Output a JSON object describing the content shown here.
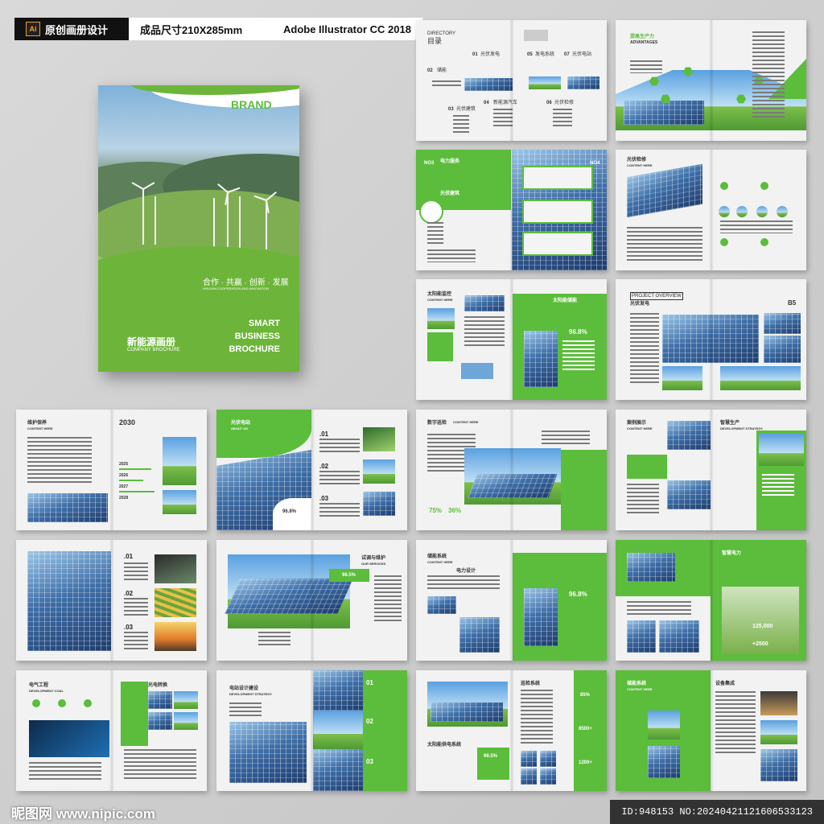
{
  "header": {
    "tag1": "原创画册设计",
    "tag2": "成品尺寸210X285mm",
    "tag3": "Adobe Illustrator CC 2018",
    "ai_icon": "Ai"
  },
  "cover": {
    "brand": "BRAND",
    "slogan_cn": "合作 · 共赢 · 创新 · 发展",
    "slogan_en": "WIN-WIN COOPERATION AND INNOVATION",
    "smart_lines": [
      "SMART",
      "BUSINESS",
      "BROCHURE"
    ],
    "title_cn": "新能源画册",
    "title_en": "COMPANY BROCHURE"
  },
  "spreads": {
    "s1": {
      "directory": "DIRECTORY",
      "directory_cn": "目录",
      "items": [
        "01",
        "02",
        "03",
        "04",
        "05",
        "06",
        "07"
      ],
      "labels": [
        "光伏发电",
        "储能",
        "发电系统",
        "光伏建筑",
        "新能源汽车",
        "光伏检修",
        "光伏电站"
      ]
    },
    "s2": {
      "title": "提高生产力",
      "sub": "ADVANTAGES"
    },
    "s3": {
      "title": "电力服务",
      "sub": "光伏建筑",
      "page_l": "NO3",
      "page_r": "NO4"
    },
    "s4": {
      "title": "光伏检修",
      "sub": "CONTENT HERE"
    },
    "s5": {
      "title": "太阳能监控",
      "sub": "CONTENT HERE",
      "title_r": "太阳能储能",
      "percent": "96.8%"
    },
    "s6": {
      "title": "PROJECT OVERVIEW",
      "sub": "光伏发电",
      "page": "B5"
    },
    "s7": {
      "title": "维护保养",
      "sub": "CONTENT HERE",
      "year": "2030",
      "years": [
        "2025",
        "2026",
        "2027",
        "2028"
      ]
    },
    "s8": {
      "title": "光伏电站",
      "sub": "ABOUT US",
      "nums": [
        ".01",
        ".02",
        ".03"
      ],
      "percent": "96.8%"
    },
    "s9": {
      "title": "数字巡检",
      "sub": "CONTENT HERE",
      "stats": [
        "75%",
        "36%"
      ]
    },
    "s10": {
      "title": "案例展示",
      "sub": "CONTENT HERE",
      "title_r": "智慧生产",
      "sub_r": "DEVELOPMENT STRATEGY"
    },
    "s11": {
      "nums": [
        ".01",
        ".02",
        ".03"
      ]
    },
    "s12": {
      "title": "试调与维护",
      "sub": "OUR SERVICES",
      "percent": "98.5%"
    },
    "s13": {
      "title": "储能系统",
      "sub": "CONTENT HERE",
      "title2": "电力设计",
      "percent": "96.8%"
    },
    "s14": {
      "title": "智慧电力",
      "stats": [
        "125,000",
        "+2500"
      ]
    },
    "s15": {
      "title": "电气工程",
      "sub": "DEVELOPMENT COAL",
      "title_r": "光电转换"
    },
    "s16": {
      "title": "电站设计建设",
      "sub": "DEVELOPMENT STRATEGY",
      "nums": [
        "01",
        "02",
        "03"
      ]
    },
    "s17": {
      "title": "巡检系统",
      "sub": "太阳能供电系统",
      "percent": "98.5%",
      "stats": [
        "85%",
        "8500+",
        "1200+"
      ]
    },
    "s18": {
      "title": "储能系统",
      "sub": "CONTENT HERE",
      "title_r": "设备集成"
    }
  },
  "footer": {
    "watermark": "昵图网 www.nipic.com",
    "id": "ID:948153 NO:20240421121606533123"
  },
  "colors": {
    "accent": "#5bbd3b",
    "dark": "#111111"
  }
}
